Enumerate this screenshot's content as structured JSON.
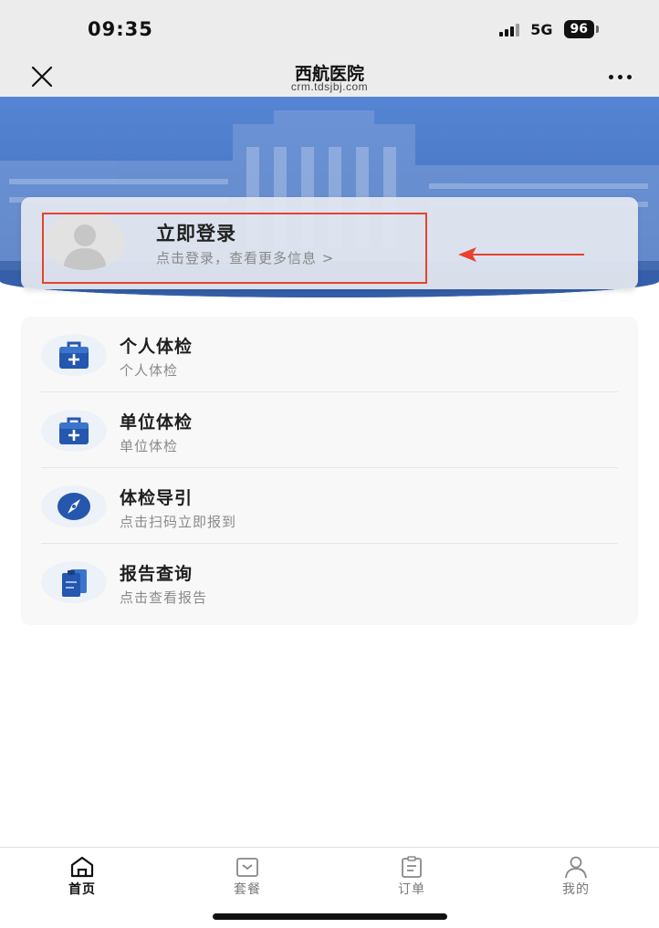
{
  "status_bar": {
    "time": "09:35",
    "network": "5G",
    "battery": "96"
  },
  "nav": {
    "title": "西航医院",
    "subtitle": "crm.tdsjbj.com",
    "close_icon": "close-icon",
    "more_icon": "more-dots-icon"
  },
  "login": {
    "title": "立即登录",
    "subtitle": "点击登录，查看更多信息 >",
    "annotation_color": "#e8412f"
  },
  "menu": {
    "items": [
      {
        "title": "个人体检",
        "subtitle": "个人体检",
        "icon": "medical-kit-icon"
      },
      {
        "title": "单位体检",
        "subtitle": "单位体检",
        "icon": "medical-kit-icon"
      },
      {
        "title": "体检导引",
        "subtitle": "点击扫码立即报到",
        "icon": "compass-icon"
      },
      {
        "title": "报告查询",
        "subtitle": "点击查看报告",
        "icon": "report-icon"
      }
    ]
  },
  "tabs": [
    {
      "label": "首页",
      "icon": "home-icon",
      "active": true
    },
    {
      "label": "套餐",
      "icon": "package-icon",
      "active": false
    },
    {
      "label": "订单",
      "icon": "order-clipboard-icon",
      "active": false
    },
    {
      "label": "我的",
      "icon": "user-icon",
      "active": false
    }
  ],
  "colors": {
    "brand_blue": "#1f5bb5",
    "banner_blue": "#4a78c4",
    "annotation_red": "#e8412f"
  }
}
